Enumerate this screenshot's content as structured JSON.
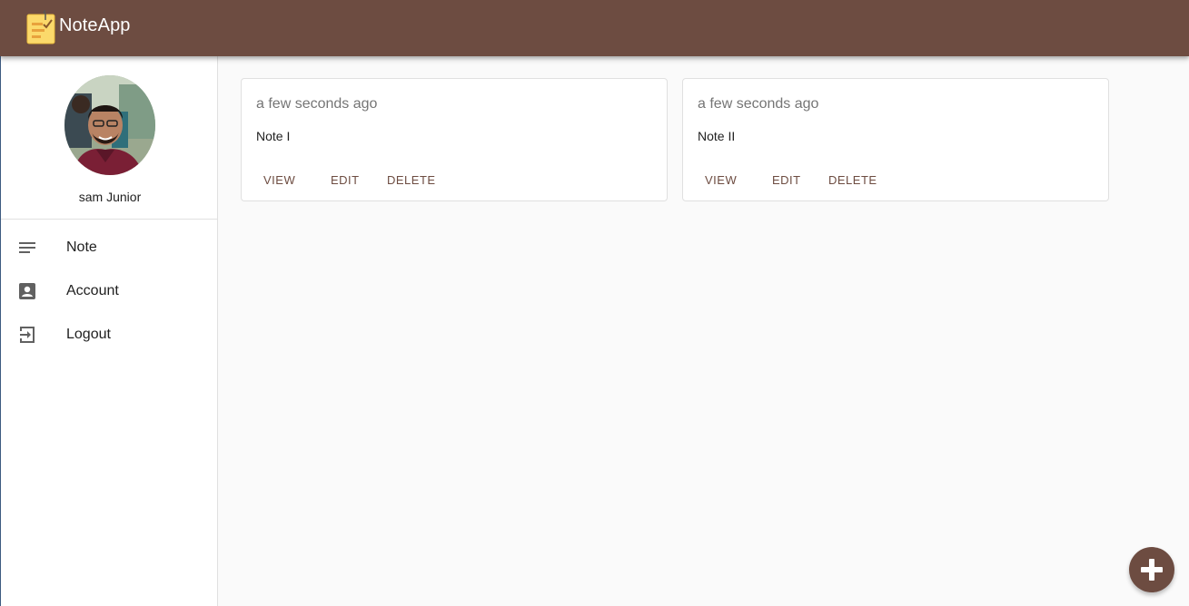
{
  "app": {
    "title": "NoteApp",
    "logo_icon": "sticky-note-icon",
    "colors": {
      "primary": "#6d4c41",
      "background": "#fafafa",
      "surface": "#ffffff",
      "muted_text": "#757575"
    }
  },
  "profile": {
    "name": "sam Junior",
    "avatar_icon": "avatar-photo"
  },
  "nav": {
    "items": [
      {
        "label": "Note",
        "icon": "notes-lines-icon"
      },
      {
        "label": "Account",
        "icon": "account-box-icon"
      },
      {
        "label": "Logout",
        "icon": "logout-icon"
      }
    ]
  },
  "notes": [
    {
      "time": "a few seconds ago",
      "body": "Note I",
      "actions": {
        "view": "VIEW",
        "edit": "EDIT",
        "delete": "DELETE"
      }
    },
    {
      "time": "a few seconds ago",
      "body": "Note II",
      "actions": {
        "view": "VIEW",
        "edit": "EDIT",
        "delete": "DELETE"
      }
    }
  ],
  "fab": {
    "icon": "plus-icon"
  }
}
